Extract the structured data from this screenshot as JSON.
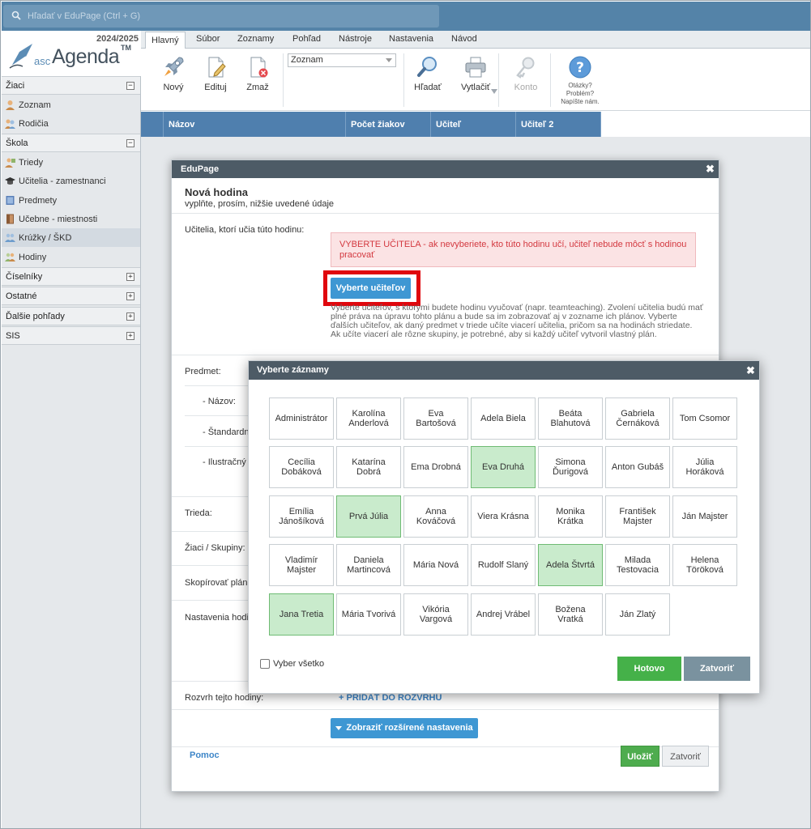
{
  "search": {
    "placeholder": "Hľadať v EduPage (Ctrl + G)"
  },
  "app": {
    "year": "2024/2025",
    "brand_prefix": "asc",
    "brand": "Agenda",
    "tm": "TM"
  },
  "sidebar": {
    "sections": [
      {
        "label": "Žiaci",
        "toggle": "−"
      },
      {
        "label": "Škola",
        "toggle": "−"
      },
      {
        "label": "Číselníky",
        "toggle": "+"
      },
      {
        "label": "Ostatné",
        "toggle": "+"
      },
      {
        "label": "Ďalšie pohľady",
        "toggle": "+"
      },
      {
        "label": "SIS",
        "toggle": "+"
      }
    ],
    "items": [
      {
        "label": "Zoznam",
        "icon": "student-icon"
      },
      {
        "label": "Rodičia",
        "icon": "parents-icon"
      },
      {
        "label": "Triedy",
        "icon": "class-icon"
      },
      {
        "label": "Učitelia - zamestnanci",
        "icon": "graduation-cap-icon"
      },
      {
        "label": "Predmety",
        "icon": "book-icon"
      },
      {
        "label": "Učebne - miestnosti",
        "icon": "door-icon"
      },
      {
        "label": "Krúžky / ŠKD",
        "icon": "group-icon"
      },
      {
        "label": "Hodiny",
        "icon": "lessons-icon"
      }
    ]
  },
  "ribbon": {
    "tabs": [
      "Hlavný",
      "Súbor",
      "Zoznamy",
      "Pohľad",
      "Nástroje",
      "Nastavenia",
      "Návod"
    ],
    "new": "Nový",
    "edit": "Edituj",
    "delete": "Zmaž",
    "select_value": "Zoznam",
    "find": "Hľadať",
    "print": "Vytlačiť",
    "account": "Konto",
    "help_line1": "Otázky?",
    "help_line2": "Problém?",
    "help_line3": "Napíšte nám."
  },
  "grid": {
    "columns": [
      "Názov",
      "Počet žiakov",
      "Učiteľ",
      "Učiteľ 2"
    ]
  },
  "dialog": {
    "window_title": "EduPage",
    "title": "Nová hodina",
    "subtitle": "vyplňte, prosím, nižšie uvedené údaje",
    "teachers_label": "Učitelia, ktorí učia túto hodinu:",
    "error_text": "VYBERTE UČITEĽA - ak nevyberiete, kto túto hodinu učí, učiteľ nebude môcť s hodinou pracovať",
    "select_teachers_btn": "Vyberte učiteľov",
    "help_text": "Vyberte učiteľov, s ktorými budete hodinu vyučovať (napr. teamteaching). Zvolení učitelia budú mať plné práva na úpravu tohto plánu a bude sa im zobrazovať aj v zozname ich plánov. Vyberte ďalších učiteľov, ak daný predmet v triede učíte viacerí učitelia, pričom sa na hodinách striedate. Ak učíte viacerí ale rôzne skupiny, je potrebné, aby si každý učiteľ vytvoril vlastný plán.",
    "subject_label": "Predmet:",
    "name_label": "- Názov:",
    "standard_label": "- Štandardn",
    "illustrative_label": "- Ilustračný",
    "class_label": "Trieda:",
    "students_label": "Žiaci / Skupiny:",
    "copy_plan_label": "Skopírovať plán:",
    "settings_label": "Nastavenia hodi",
    "schedule_label": "Rozvrh tejto hodiny:",
    "add_to_schedule": "+ PRIDAŤ DO ROZVRHU",
    "advanced_btn": "Zobraziť rozšírené nastavenia",
    "help_link": "Pomoc",
    "save_btn": "Uložiť",
    "close_btn": "Zatvoriť"
  },
  "picker": {
    "title": "Vyberte záznamy",
    "select_all": "Vyber všetko",
    "done_btn": "Hotovo",
    "close_btn": "Zatvoriť",
    "people": [
      {
        "name": "Administrátor",
        "selected": false
      },
      {
        "name": "Karolína Anderlová",
        "selected": false
      },
      {
        "name": "Eva Bartošová",
        "selected": false
      },
      {
        "name": "Adela Biela",
        "selected": false
      },
      {
        "name": "Beáta Blahutová",
        "selected": false
      },
      {
        "name": "Gabriela Černáková",
        "selected": false
      },
      {
        "name": "Tom Csomor",
        "selected": false
      },
      {
        "name": "Cecília Dobáková",
        "selected": false
      },
      {
        "name": "Katarína Dobrá",
        "selected": false
      },
      {
        "name": "Ema Drobná",
        "selected": false
      },
      {
        "name": "Eva Druhá",
        "selected": true
      },
      {
        "name": "Simona Ďurigová",
        "selected": false
      },
      {
        "name": "Anton Gubáš",
        "selected": false
      },
      {
        "name": "Júlia Horáková",
        "selected": false
      },
      {
        "name": "Emília Jánošíková",
        "selected": false
      },
      {
        "name": "Prvá Júlia",
        "selected": true
      },
      {
        "name": "Anna Kováčová",
        "selected": false
      },
      {
        "name": "Viera Krásna",
        "selected": false
      },
      {
        "name": "Monika Krátka",
        "selected": false
      },
      {
        "name": "František Majster",
        "selected": false
      },
      {
        "name": "Ján Majster",
        "selected": false
      },
      {
        "name": "Vladimír Majster",
        "selected": false
      },
      {
        "name": "Daniela Martincová",
        "selected": false
      },
      {
        "name": "Mária Nová",
        "selected": false
      },
      {
        "name": "Rudolf Slaný",
        "selected": false
      },
      {
        "name": "Adela Štvrtá",
        "selected": true
      },
      {
        "name": "Milada Testovacia",
        "selected": false
      },
      {
        "name": "Helena Töröková",
        "selected": false
      },
      {
        "name": "Jana Tretia",
        "selected": true
      },
      {
        "name": "Mária Tvorivá",
        "selected": false
      },
      {
        "name": "Vikória Vargová",
        "selected": false
      },
      {
        "name": "Andrej Vrábel",
        "selected": false
      },
      {
        "name": "Božena Vratká",
        "selected": false
      },
      {
        "name": "Ján Zlatý",
        "selected": false
      }
    ]
  },
  "colors": {
    "accent_blue": "#3e97d3",
    "selected_bg": "#c9ebcc",
    "header_dark": "#4d5b66",
    "highlight_red": "#e0070d"
  }
}
